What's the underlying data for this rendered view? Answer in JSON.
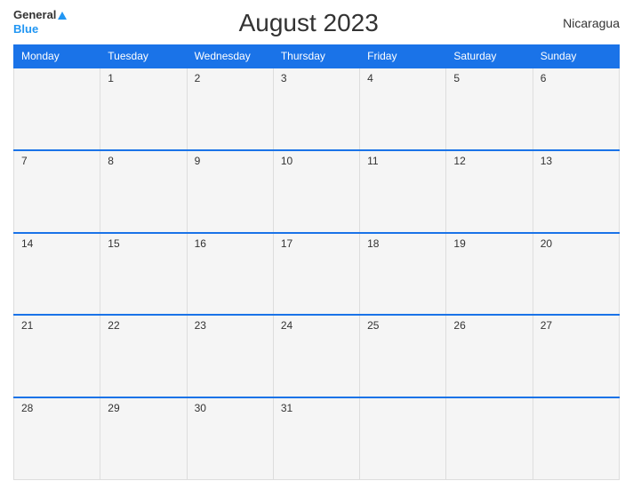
{
  "header": {
    "logo_general": "General",
    "logo_blue": "Blue",
    "title": "August 2023",
    "country": "Nicaragua"
  },
  "days": {
    "headers": [
      "Monday",
      "Tuesday",
      "Wednesday",
      "Thursday",
      "Friday",
      "Saturday",
      "Sunday"
    ]
  },
  "weeks": [
    [
      "",
      "1",
      "2",
      "3",
      "4",
      "5",
      "6"
    ],
    [
      "7",
      "8",
      "9",
      "10",
      "11",
      "12",
      "13"
    ],
    [
      "14",
      "15",
      "16",
      "17",
      "18",
      "19",
      "20"
    ],
    [
      "21",
      "22",
      "23",
      "24",
      "25",
      "26",
      "27"
    ],
    [
      "28",
      "29",
      "30",
      "31",
      "",
      "",
      ""
    ]
  ]
}
